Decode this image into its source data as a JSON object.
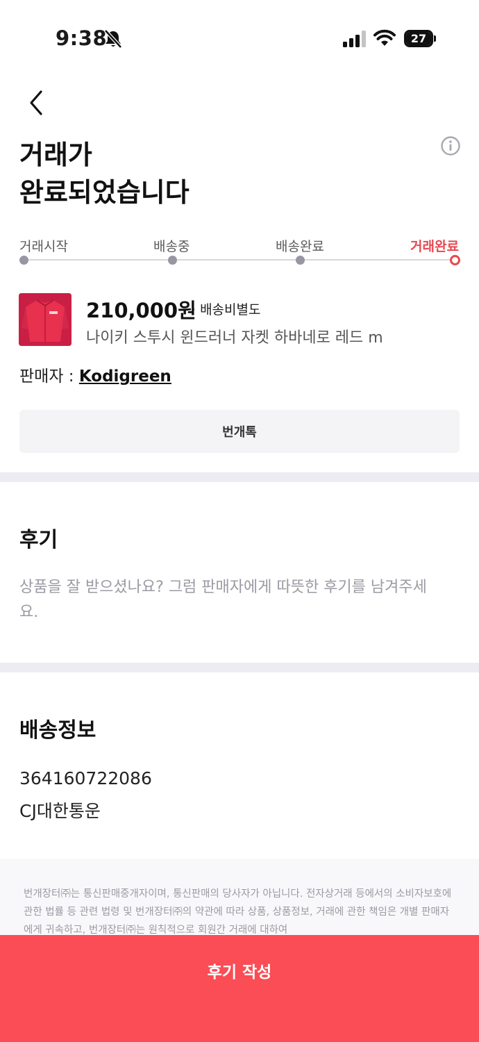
{
  "status_bar": {
    "time": "9:38",
    "battery": "27",
    "battery_level": 0.27,
    "icons": [
      "bell-slash-icon",
      "signal-icon",
      "wifi-icon",
      "battery-icon"
    ]
  },
  "header": {
    "title_line1": "거래가",
    "title_line2": "완료되었습니다",
    "back_icon": "chevron-left-icon",
    "info_icon": "info-circle-icon"
  },
  "steps": [
    {
      "label": "거래시작",
      "active": false
    },
    {
      "label": "배송중",
      "active": false
    },
    {
      "label": "배송완료",
      "active": false
    },
    {
      "label": "거래완료",
      "active": true
    }
  ],
  "product": {
    "price": "210,000원",
    "shipping": "· 배송비별도",
    "name": "나이키 스투시 윈드러너 자켓 하바네로 레드 m",
    "seller_label": "판매자 : ",
    "seller_name": "Kodigreen"
  },
  "chat_button": "번개톡",
  "review": {
    "title": "후기",
    "text": "상품을 잘 받으셨나요? 그럼 판매자에게 따뜻한 후기를 남겨주세요."
  },
  "shipping_info": {
    "title": "배송정보",
    "tracking_number": "364160722086",
    "carrier": "CJ대한통운"
  },
  "disclaimer": "번개장터㈜는 통신판매중개자이며, 통신판매의 당사자가 아닙니다. 전자상거래 등에서의 소비자보호에 관한 법률 등 관련 법령 및 번개장터㈜의 약관에 따라 상품, 상품정보, 거래에 관한 책임은 개별 판매자에게 귀속하고, 번개장터㈜는 원칙적으로 회원간 거래에 대하여",
  "bottom_button": "후기 작성",
  "colors": {
    "accent": "#fa4d55",
    "active_step": "#e8484f",
    "product_image": "#d8274b"
  }
}
